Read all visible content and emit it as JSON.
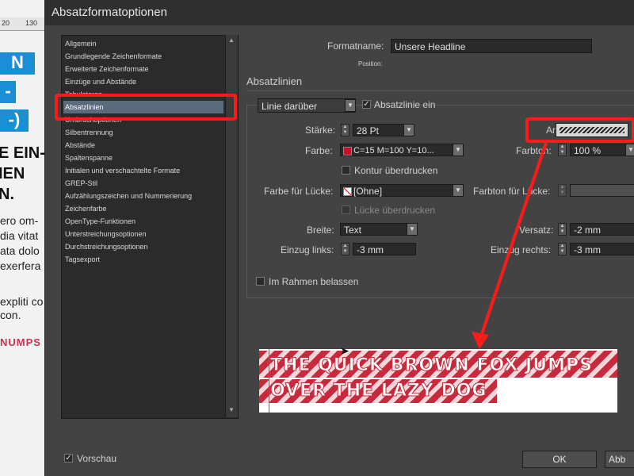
{
  "document": {
    "ruler_ticks": [
      "20",
      "130"
    ],
    "blue_boxes": [
      "N",
      "-",
      "-)"
    ],
    "bold_lines": [
      "E EIN-",
      "IEN",
      "N."
    ],
    "text_lines": [
      "ero om-",
      "dia vitat",
      "ata dolo",
      "exerfera",
      "expliti co",
      "con."
    ],
    "caps_text": "NUMPS"
  },
  "dialog": {
    "title": "Absatzformatoptionen",
    "formatname_label": "Formatname:",
    "formatname_value": "Unsere Headline",
    "position_label": "Position:",
    "section_title": "Absatzlinien",
    "categories": [
      "Allgemein",
      "Grundlegende Zeichenformate",
      "Erweiterte Zeichenformate",
      "Einzüge und Abstände",
      "Tabulatoren",
      "Absatzlinien",
      "Umbruchoptionen",
      "Silbentrennung",
      "Abstände",
      "Spaltenspanne",
      "Initialen und verschachtelte Formate",
      "GREP-Stil",
      "Aufzählungszeichen und Nummerierung",
      "Zeichenfarbe",
      "OpenType-Funktionen",
      "Unterstreichungsoptionen",
      "Durchstreichungsoptionen",
      "Tagsexport"
    ],
    "selected_category": "Absatzlinien",
    "rule_position": "Linie darüber",
    "rule_on_label": "Absatzlinie ein",
    "staerke_label": "Stärke:",
    "staerke_value": "28 Pt",
    "art_label": "Art:",
    "farbe_label": "Farbe:",
    "farbe_value": "C=15 M=100 Y=10...",
    "farbton_label": "Farbton:",
    "farbton_value": "100 %",
    "kontur_label": "Kontur überdrucken",
    "luecke_farbe_label": "Farbe für Lücke:",
    "luecke_farbe_value": "[Ohne]",
    "luecke_farbton_label": "Farbton für Lücke:",
    "luecke_ueberdrucken_label": "Lücke überdrucken",
    "breite_label": "Breite:",
    "breite_value": "Text",
    "versatz_label": "Versatz:",
    "versatz_value": "-2 mm",
    "einzug_links_label": "Einzug links:",
    "einzug_links_value": "-3 mm",
    "einzug_rechts_label": "Einzug rechts:",
    "einzug_rechts_value": "-3 mm",
    "rahmen_label": "Im Rahmen belassen",
    "vorschau_label": "Vorschau",
    "ok_label": "OK",
    "abbrechen_label": "Abb",
    "preview_line1": "THE QUICK BROWN FOX JUMPS",
    "preview_line2": "OVER THE LAZY DOG",
    "colors": {
      "accent_red": "#ff1a1a",
      "rule_red": "#c72a3c",
      "doc_blue": "#1b8fd6"
    },
    "icons": [
      "checkbox-icon",
      "chevron-down-icon",
      "spinner-arrows-icon",
      "stripe-pattern-icon",
      "swatch-icon",
      "none-swatch-icon",
      "cursor-icon"
    ]
  }
}
